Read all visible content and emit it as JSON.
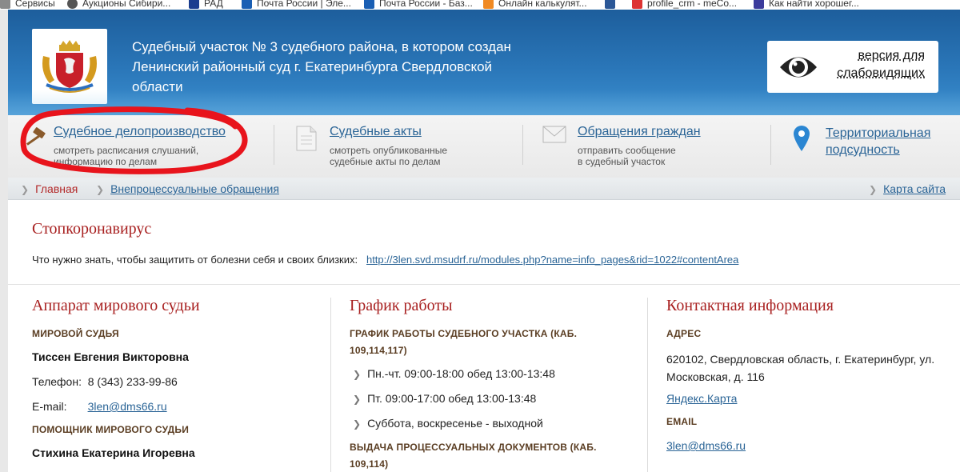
{
  "bookmarks": [
    {
      "label": "Сервисы",
      "color": "#8a8a8a"
    },
    {
      "label": "Аукционы Сибири...",
      "color": "#555555"
    },
    {
      "label": "РАД",
      "color": "#1a3d8f"
    },
    {
      "label": "Почта России | Эле...",
      "color": "#1a5fb4"
    },
    {
      "label": "Почта России - Баз...",
      "color": "#1a5fb4"
    },
    {
      "label": "Онлайн калькулят...",
      "color": "#f08a24"
    },
    {
      "label": "",
      "color": "#2b5797"
    },
    {
      "label": "profile_crm - meCo...",
      "color": "#d33"
    },
    {
      "label": "Как найти хорошег...",
      "color": "#3b3b9c"
    }
  ],
  "header": {
    "title": "Судебный участок № 3 судебного района, в котором создан Ленинский районный суд г. Екатеринбурга Свердловской области",
    "vision_label_1": "версия для",
    "vision_label_2": "слабовидящих"
  },
  "nav": [
    {
      "title": "Судебное делопроизводство",
      "sub1": "смотреть расписания слушаний,",
      "sub2": "информацию по делам"
    },
    {
      "title": "Судебные акты",
      "sub1": "смотреть опубликованные",
      "sub2": "судебные акты по делам"
    },
    {
      "title": "Обращения граждан",
      "sub1": "отправить сообщение",
      "sub2": "в судебный участок"
    },
    {
      "title1": "Территориальная",
      "title2": "подсудность"
    }
  ],
  "breadcrumb": {
    "home": "Главная",
    "item": "Внепроцессуальные обращения",
    "sitemap": "Карта сайта"
  },
  "corona": {
    "title": "Стопкоронавирус",
    "text": "Что нужно знать, чтобы защитить от болезни себя и своих близких:",
    "link": "http://3len.svd.msudrf.ru/modules.php?name=info_pages&rid=1022#contentArea"
  },
  "apparatus": {
    "title": "Аппарат мирового судьи",
    "judge_caption": "МИРОВОЙ СУДЬЯ",
    "judge_name": "Тиссен Евгения Викторовна",
    "phone_label": "Телефон:",
    "phone": "8 (343) 233-99-86",
    "email_label": "E-mail:",
    "email": "3len@dms66.ru",
    "assistant_caption": "ПОМОЩНИК МИРОВОГО СУДЬИ",
    "assistant_name": "Стихина Екатерина Игоревна"
  },
  "schedule": {
    "title": "График работы",
    "caption1_line1": "ГРАФИК РАБОТЫ СУДЕБНОГО УЧАСТКА (КАБ.",
    "caption1_line2": "109,114,117)",
    "items": [
      "Пн.-чт. 09:00-18:00 обед 13:00-13:48",
      "Пт. 09:00-17:00 обед 13:00-13:48",
      "Суббота, воскресенье - выходной"
    ],
    "caption2_line1": "ВЫДАЧА ПРОЦЕССУАЛЬНЫХ ДОКУМЕНТОВ (КАБ.",
    "caption2_line2": "109,114)"
  },
  "contacts": {
    "title": "Контактная информация",
    "address_caption": "АДРЕС",
    "address_line1": "620102, Свердловская область, г. Екатеринбург, ул.",
    "address_line2": "Московская, д. 116",
    "map_link": "Яндекс.Карта",
    "email_caption": "EMAIL",
    "email": "3len@dms66.ru"
  },
  "colors": {
    "header_blue": "#2a76b8",
    "link_blue": "#2a6496",
    "title_red": "#a82020",
    "annotation_red": "#e8141c"
  }
}
